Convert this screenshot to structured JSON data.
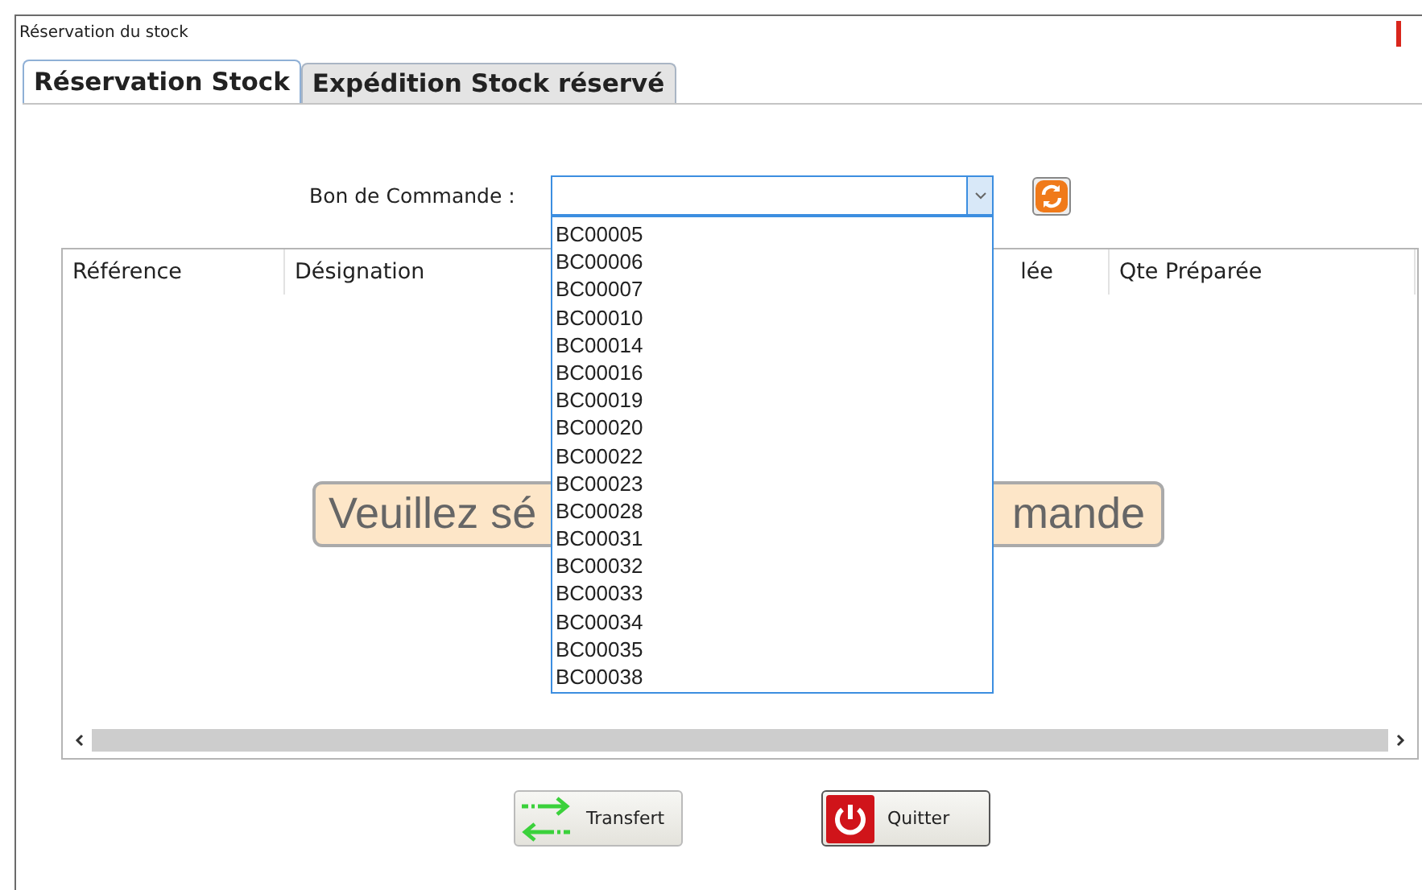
{
  "window": {
    "title": "Réservation du stock"
  },
  "tabs": [
    {
      "label": "Réservation Stock",
      "selected": true
    },
    {
      "label": "Expédition Stock réservé",
      "selected": false
    }
  ],
  "order_field": {
    "label": "Bon de Commande :",
    "expanded": true,
    "options": [
      "BC00005",
      "BC00006",
      "BC00007",
      "BC00010",
      "BC00014",
      "BC00016",
      "BC00019",
      "BC00020",
      "BC00022",
      "BC00023",
      "BC00028",
      "BC00031",
      "BC00032",
      "BC00033",
      "BC00034",
      "BC00035",
      "BC00038"
    ]
  },
  "table": {
    "columns": [
      {
        "label": "Référence"
      },
      {
        "label": "Désignation"
      },
      {
        "label": "lée"
      },
      {
        "label": "Qte Préparée"
      }
    ],
    "empty_message": {
      "left": "Veuillez sé",
      "right": "mande"
    }
  },
  "buttons": [
    {
      "kind": "transfer",
      "label": "Transfert"
    },
    {
      "kind": "quit",
      "label": "Quitter"
    }
  ]
}
